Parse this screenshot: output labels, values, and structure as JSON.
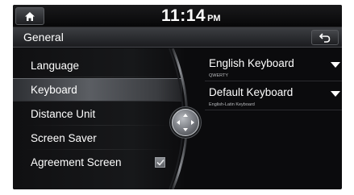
{
  "status_bar": {
    "time": "11:14",
    "ampm": "PM"
  },
  "header": {
    "title": "General"
  },
  "menu": {
    "items": [
      {
        "label": "Language",
        "selected": false
      },
      {
        "label": "Keyboard",
        "selected": true
      },
      {
        "label": "Distance Unit",
        "selected": false
      },
      {
        "label": "Screen Saver",
        "selected": false
      },
      {
        "label": "Agreement Screen",
        "selected": false,
        "checked": true
      }
    ]
  },
  "options": [
    {
      "title": "English Keyboard",
      "subtitle": "QWERTY"
    },
    {
      "title": "Default Keyboard",
      "subtitle": "English-Latin Keyboard"
    }
  ],
  "icons": {
    "home": "home-icon",
    "back": "back-arrow-icon",
    "dropdown": "dropdown-arrow-icon",
    "joystick": "joystick-dpad-icon",
    "check": "checkmark-icon"
  },
  "colors": {
    "background": "#0b0b0d",
    "selected_row": "#5b5e63",
    "text": "#ffffff",
    "subtext": "#b9bbbe"
  }
}
